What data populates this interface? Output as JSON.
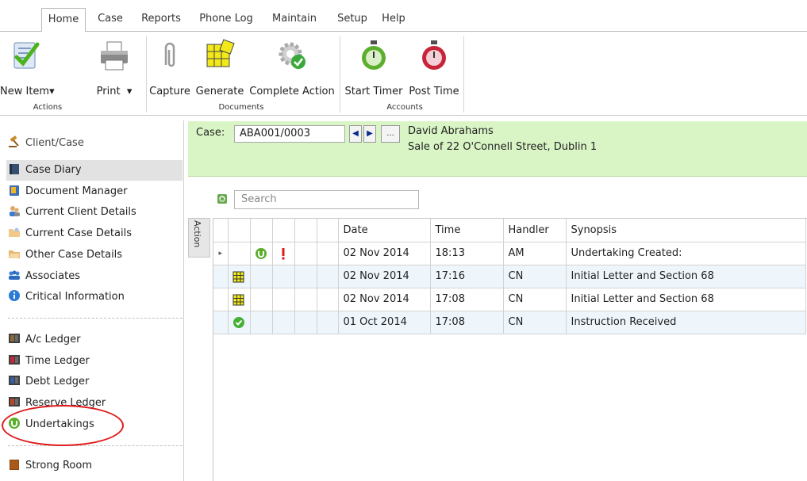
{
  "menu": {
    "tabs": [
      "Home",
      "Case",
      "Reports",
      "Phone Log",
      "Maintain",
      "Setup",
      "Help"
    ],
    "active": "Home"
  },
  "ribbon": {
    "new_item": "New Item",
    "print": "Print",
    "actions_group": "Actions",
    "capture": "Capture",
    "generate": "Generate",
    "complete_action": "Complete Action",
    "documents_group": "Documents",
    "start_timer": "Start Timer",
    "post_time": "Post Time",
    "accounts_group": "Accounts",
    "dropdown_arrow": "▾"
  },
  "nav": {
    "client_case": "Client/Case",
    "case_diary": "Case Diary",
    "document_manager": "Document Manager",
    "current_client_details": "Current Client Details",
    "current_case_details": "Current Case Details",
    "other_case_details": "Other Case Details",
    "associates": "Associates",
    "critical_information": "Critical Information",
    "ac_ledger": "A/c Ledger",
    "time_ledger": "Time Ledger",
    "debt_ledger": "Debt Ledger",
    "reserve_ledger": "Reserve Ledger",
    "undertakings": "Undertakings",
    "strong_room": "Strong Room"
  },
  "case": {
    "label": "Case:",
    "value": "ABA001/0003",
    "prev": "◀",
    "next": "▶",
    "more": "...",
    "client_name": "David Abrahams",
    "matter": "Sale of 22 O'Connell Street, Dublin 1"
  },
  "search": {
    "placeholder": "Search"
  },
  "grid": {
    "action_label": "Action",
    "headers": {
      "date": "Date",
      "time": "Time",
      "handler": "Handler",
      "synopsis": "Synopsis"
    },
    "rows": [
      {
        "date": "02 Nov 2014",
        "time": "18:13",
        "handler": "AM",
        "synopsis": "Undertaking Created:",
        "current_marker": "▸"
      },
      {
        "date": "02 Nov 2014",
        "time": "17:16",
        "handler": "CN",
        "synopsis": "Initial Letter and Section 68"
      },
      {
        "date": "02 Nov 2014",
        "time": "17:08",
        "handler": "CN",
        "synopsis": "Initial Letter and Section 68"
      },
      {
        "date": "01 Oct 2014",
        "time": "17:08",
        "handler": "CN",
        "synopsis": "Instruction Received"
      }
    ]
  },
  "colors": {
    "case_bar": "#d9f5c5",
    "highlight_circle": "#e01b1b",
    "alt_row": "#eef6fc"
  }
}
